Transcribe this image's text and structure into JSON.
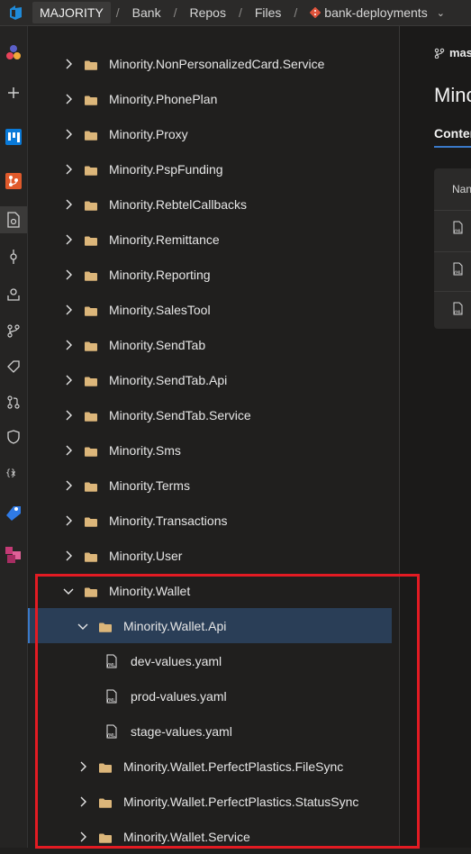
{
  "topbar": {
    "org": "MAJORITY",
    "project": "Bank",
    "section": "Repos",
    "page": "Files",
    "repo": "bank-deployments",
    "separator": "/"
  },
  "rail": {
    "items": [
      {
        "icon": "azure-devops-logo-icon",
        "color": "#0078d4"
      },
      {
        "icon": "project-avatar-icon"
      },
      {
        "icon": "add-icon"
      },
      {
        "icon": "boards-icon",
        "color": "#0a7ad8"
      },
      {
        "icon": "repos-icon",
        "color": "#e05a2b"
      },
      {
        "icon": "files-icon"
      },
      {
        "icon": "commits-icon"
      },
      {
        "icon": "pushes-icon"
      },
      {
        "icon": "branches-icon"
      },
      {
        "icon": "tags-icon"
      },
      {
        "icon": "pull-requests-icon"
      },
      {
        "icon": "advanced-security-icon"
      },
      {
        "icon": "variables-icon"
      },
      {
        "icon": "pipelines-icon",
        "color": "#2f7ae5"
      },
      {
        "icon": "artifacts-icon",
        "color": "#c43a75"
      }
    ]
  },
  "tree": {
    "items": [
      {
        "label": "Minority.NonPersonalizedCard.Service",
        "type": "folder",
        "state": "collapsed",
        "level": 0
      },
      {
        "label": "Minority.PhonePlan",
        "type": "folder",
        "state": "collapsed",
        "level": 0
      },
      {
        "label": "Minority.Proxy",
        "type": "folder",
        "state": "collapsed",
        "level": 0
      },
      {
        "label": "Minority.PspFunding",
        "type": "folder",
        "state": "collapsed",
        "level": 0
      },
      {
        "label": "Minority.RebtelCallbacks",
        "type": "folder",
        "state": "collapsed",
        "level": 0
      },
      {
        "label": "Minority.Remittance",
        "type": "folder",
        "state": "collapsed",
        "level": 0
      },
      {
        "label": "Minority.Reporting",
        "type": "folder",
        "state": "collapsed",
        "level": 0
      },
      {
        "label": "Minority.SalesTool",
        "type": "folder",
        "state": "collapsed",
        "level": 0
      },
      {
        "label": "Minority.SendTab",
        "type": "folder",
        "state": "collapsed",
        "level": 0
      },
      {
        "label": "Minority.SendTab.Api",
        "type": "folder",
        "state": "collapsed",
        "level": 0
      },
      {
        "label": "Minority.SendTab.Service",
        "type": "folder",
        "state": "collapsed",
        "level": 0
      },
      {
        "label": "Minority.Sms",
        "type": "folder",
        "state": "collapsed",
        "level": 0
      },
      {
        "label": "Minority.Terms",
        "type": "folder",
        "state": "collapsed",
        "level": 0
      },
      {
        "label": "Minority.Transactions",
        "type": "folder",
        "state": "collapsed",
        "level": 0
      },
      {
        "label": "Minority.User",
        "type": "folder",
        "state": "collapsed",
        "level": 0
      },
      {
        "label": "Minority.Wallet",
        "type": "folder",
        "state": "expanded",
        "level": 0
      },
      {
        "label": "Minority.Wallet.Api",
        "type": "folder",
        "state": "expanded",
        "level": 1,
        "selected": true
      },
      {
        "label": "dev-values.yaml",
        "type": "yaml",
        "level": 2
      },
      {
        "label": "prod-values.yaml",
        "type": "yaml",
        "level": 2
      },
      {
        "label": "stage-values.yaml",
        "type": "yaml",
        "level": 2
      },
      {
        "label": "Minority.Wallet.PerfectPlastics.FileSync",
        "type": "folder",
        "state": "collapsed",
        "level": 1
      },
      {
        "label": "Minority.Wallet.PerfectPlastics.StatusSync",
        "type": "folder",
        "state": "collapsed",
        "level": 1
      },
      {
        "label": "Minority.Wallet.Service",
        "type": "folder",
        "state": "collapsed",
        "level": 1
      }
    ]
  },
  "right": {
    "branch": "mas",
    "title": "Minc",
    "tab": "Conter",
    "table_header": "Nan",
    "file_icon_text": "YML"
  },
  "colors": {
    "accent": "#3a79c8",
    "folder": "#dcb67a",
    "highlight": "#e31b23"
  }
}
